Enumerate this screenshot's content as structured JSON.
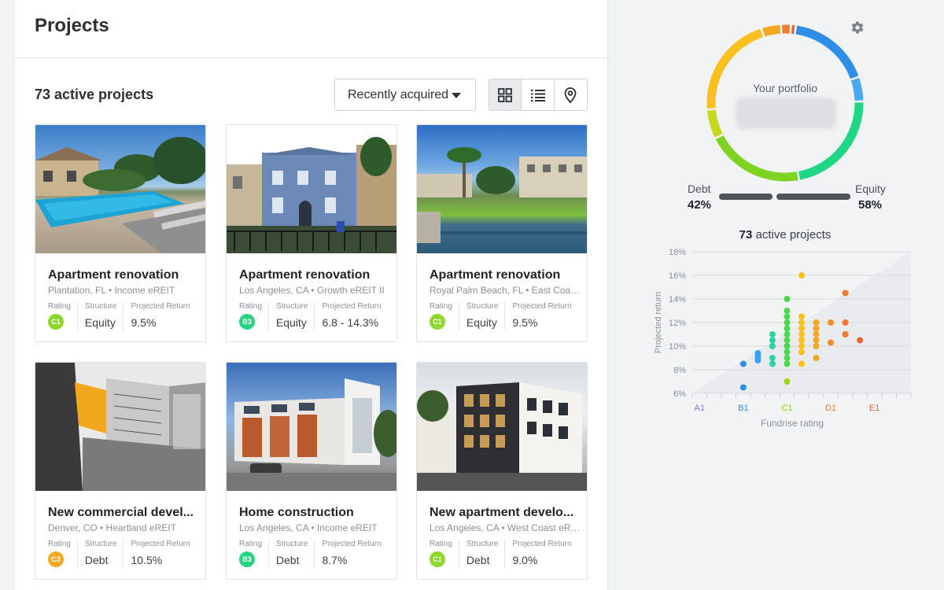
{
  "header": {
    "title": "Projects"
  },
  "toolbar": {
    "count_label": "73 active projects",
    "sort_value": "Recently acquired",
    "views": [
      "grid",
      "list",
      "map"
    ]
  },
  "meta_labels": {
    "rating": "Rating",
    "structure": "Structure",
    "return": "Projected Return"
  },
  "projects": [
    {
      "title": "Apartment renovation",
      "subtitle": "Plantation, FL • Income eREIT",
      "rating": "C1",
      "rating_color": "#8fd631",
      "structure": "Equity",
      "projected_return": "9.5%"
    },
    {
      "title": "Apartment renovation",
      "subtitle": "Los Angeles, CA • Growth eREIT II",
      "rating": "B3",
      "rating_color": "#2ad381",
      "structure": "Equity",
      "projected_return": "6.8 - 14.3%"
    },
    {
      "title": "Apartment renovation",
      "subtitle": "Royal Palm Beach, FL • East Coast eREIT",
      "rating": "C1",
      "rating_color": "#8fd631",
      "structure": "Equity",
      "projected_return": "9.5%"
    },
    {
      "title": "New commercial devel...",
      "subtitle": "Denver, CO • Heartland eREIT",
      "rating": "C3",
      "rating_color": "#f5a623",
      "structure": "Debt",
      "projected_return": "10.5%"
    },
    {
      "title": "Home construction",
      "subtitle": "Los Angeles, CA • Income eREIT",
      "rating": "B3",
      "rating_color": "#2ad381",
      "structure": "Debt",
      "projected_return": "8.7%"
    },
    {
      "title": "New apartment develo...",
      "subtitle": "Los Angeles, CA • West Coast eREIT",
      "rating": "C1",
      "rating_color": "#8fd631",
      "structure": "Debt",
      "projected_return": "9.0%"
    }
  ],
  "portfolio": {
    "label": "Your portfolio",
    "debt_label": "Debt",
    "debt_pct": "42%",
    "equity_label": "Equity",
    "equity_pct": "58%",
    "debt_fraction": 0.42
  },
  "scatter_title": {
    "count": "73",
    "text": "active projects"
  },
  "chart_data": [
    {
      "type": "pie",
      "title": "Your portfolio",
      "segments": [
        {
          "color": "#2f8fe6",
          "value": 17
        },
        {
          "color": "#4aa8f0",
          "value": 5
        },
        {
          "color": "#1fd685",
          "value": 22
        },
        {
          "color": "#7ed321",
          "value": 20
        },
        {
          "color": "#c8d81c",
          "value": 6
        },
        {
          "color": "#fbbf1f",
          "value": 21
        },
        {
          "color": "#f5a623",
          "value": 4
        },
        {
          "color": "#f17a2c",
          "value": 2
        },
        {
          "color": "#ef5f36",
          "value": 1
        }
      ]
    },
    {
      "type": "scatter",
      "ylabel": "Projected return",
      "xlabel": "Fundrise rating",
      "yticks": [
        "18%",
        "16%",
        "14%",
        "12%",
        "10%",
        "8%",
        "6%"
      ],
      "ylim": [
        6,
        18
      ],
      "xticks": [
        {
          "label": "A1",
          "color": "#8a72e0"
        },
        {
          "label": "B1",
          "color": "#2f8fe6"
        },
        {
          "label": "C1",
          "color": "#7ed321"
        },
        {
          "label": "D1",
          "color": "#f17a2c"
        },
        {
          "label": "E1",
          "color": "#ef5f36"
        }
      ],
      "grid": true,
      "points": [
        {
          "x": 3,
          "y": 6.5,
          "color": "#2f8fe6"
        },
        {
          "x": 3,
          "y": 8.5,
          "color": "#2f8fe6"
        },
        {
          "x": 4,
          "y": 8.8,
          "color": "#3d9ff0"
        },
        {
          "x": 4,
          "y": 9.1,
          "color": "#3d9ff0"
        },
        {
          "x": 4,
          "y": 9.4,
          "color": "#3d9ff0"
        },
        {
          "x": 5,
          "y": 8.5,
          "color": "#2fd3a0"
        },
        {
          "x": 5,
          "y": 9.0,
          "color": "#2fd3a0"
        },
        {
          "x": 5,
          "y": 10.0,
          "color": "#2fd3a0"
        },
        {
          "x": 5,
          "y": 10.5,
          "color": "#2fd3a0"
        },
        {
          "x": 5,
          "y": 11.0,
          "color": "#2fd3a0"
        },
        {
          "x": 6,
          "y": 8.5,
          "color": "#4cd84a"
        },
        {
          "x": 6,
          "y": 9.0,
          "color": "#4cd84a"
        },
        {
          "x": 6,
          "y": 9.5,
          "color": "#4cd84a"
        },
        {
          "x": 6,
          "y": 10.0,
          "color": "#4cd84a"
        },
        {
          "x": 6,
          "y": 10.5,
          "color": "#4cd84a"
        },
        {
          "x": 6,
          "y": 11.0,
          "color": "#4cd84a"
        },
        {
          "x": 6,
          "y": 11.5,
          "color": "#4cd84a"
        },
        {
          "x": 6,
          "y": 12.0,
          "color": "#4cd84a"
        },
        {
          "x": 6,
          "y": 12.5,
          "color": "#4cd84a"
        },
        {
          "x": 6,
          "y": 13.0,
          "color": "#4cd84a"
        },
        {
          "x": 6,
          "y": 14.0,
          "color": "#4cd84a"
        },
        {
          "x": 6,
          "y": 7.0,
          "color": "#9bd61a"
        },
        {
          "x": 7,
          "y": 8.5,
          "color": "#f7c21e"
        },
        {
          "x": 7,
          "y": 9.5,
          "color": "#f7c21e"
        },
        {
          "x": 7,
          "y": 10.0,
          "color": "#f7c21e"
        },
        {
          "x": 7,
          "y": 10.5,
          "color": "#f7c21e"
        },
        {
          "x": 7,
          "y": 11.0,
          "color": "#f7c21e"
        },
        {
          "x": 7,
          "y": 11.5,
          "color": "#f7c21e"
        },
        {
          "x": 7,
          "y": 12.0,
          "color": "#f7c21e"
        },
        {
          "x": 7,
          "y": 12.5,
          "color": "#f7c21e"
        },
        {
          "x": 7,
          "y": 16.0,
          "color": "#f7c21e"
        },
        {
          "x": 8,
          "y": 9.0,
          "color": "#f5a623"
        },
        {
          "x": 8,
          "y": 10.0,
          "color": "#f5a623"
        },
        {
          "x": 8,
          "y": 10.5,
          "color": "#f5a623"
        },
        {
          "x": 8,
          "y": 11.0,
          "color": "#f5a623"
        },
        {
          "x": 8,
          "y": 11.5,
          "color": "#f5a623"
        },
        {
          "x": 8,
          "y": 12.0,
          "color": "#f5a623"
        },
        {
          "x": 9,
          "y": 10.3,
          "color": "#f28c2a"
        },
        {
          "x": 9,
          "y": 12.0,
          "color": "#f28c2a"
        },
        {
          "x": 10,
          "y": 11.0,
          "color": "#f07830"
        },
        {
          "x": 10,
          "y": 12.0,
          "color": "#f07830"
        },
        {
          "x": 10,
          "y": 14.5,
          "color": "#f07830"
        },
        {
          "x": 11,
          "y": 10.5,
          "color": "#ef6636"
        }
      ]
    }
  ]
}
